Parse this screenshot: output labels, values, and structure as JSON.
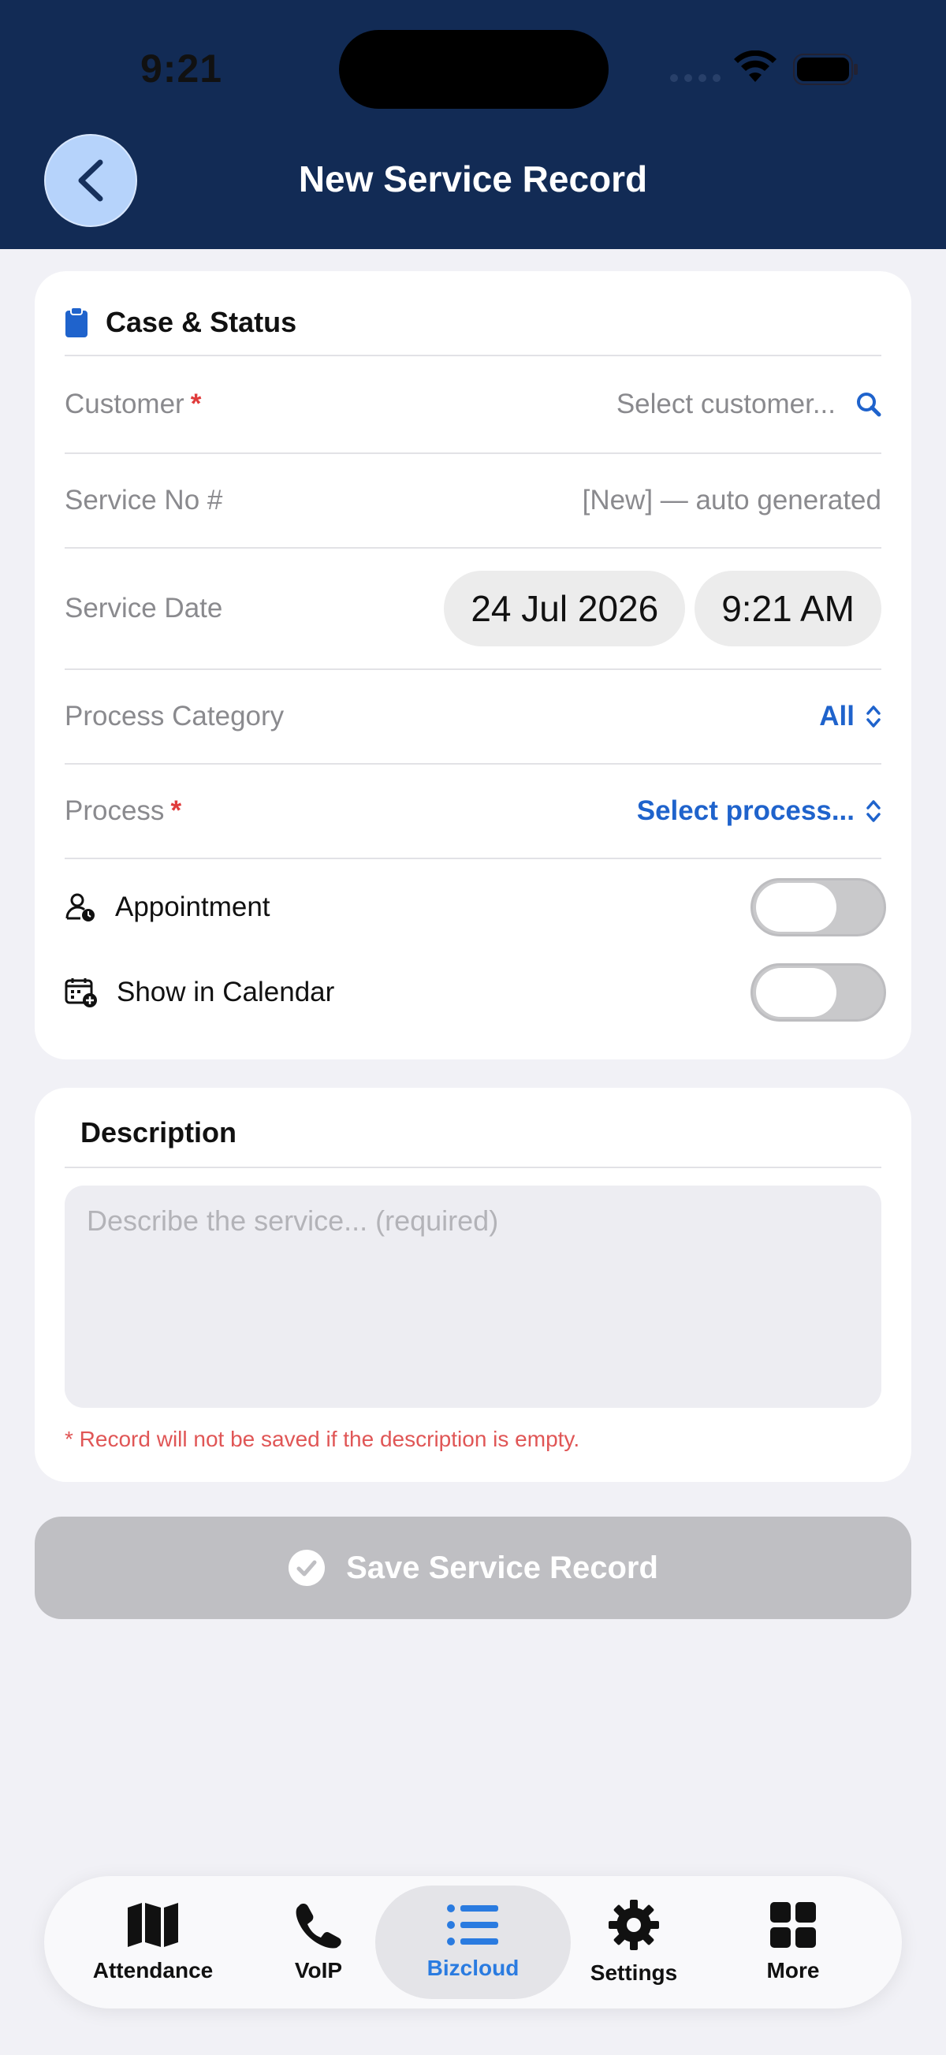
{
  "status_bar": {
    "time": "9:21"
  },
  "header": {
    "title": "New Service Record"
  },
  "case_section": {
    "title": "Case & Status",
    "customer": {
      "label": "Customer",
      "required": "*",
      "value": "Select customer..."
    },
    "service_no": {
      "label": "Service No #",
      "value": "[New] — auto generated"
    },
    "service_date": {
      "label": "Service Date",
      "date": "24 Jul 2026",
      "time": "9:21 AM"
    },
    "process_category": {
      "label": "Process Category",
      "value": "All"
    },
    "process": {
      "label": "Process",
      "required": "*",
      "value": "Select process..."
    },
    "appointment": {
      "label": "Appointment",
      "on": false
    },
    "show_in_calendar": {
      "label": "Show in Calendar",
      "on": false
    }
  },
  "description_section": {
    "title": "Description",
    "placeholder": "Describe the service... (required)",
    "warning": "* Record will not be saved if the description is empty."
  },
  "save_button": {
    "label": "Save Service Record"
  },
  "tabbar": {
    "tabs": [
      {
        "label": "Attendance",
        "icon": "map-icon"
      },
      {
        "label": "VoIP",
        "icon": "phone-icon"
      },
      {
        "label": "Bizcloud",
        "icon": "list-icon",
        "active": true
      },
      {
        "label": "Settings",
        "icon": "gear-icon"
      },
      {
        "label": "More",
        "icon": "grid-icon"
      }
    ]
  },
  "colors": {
    "header_bg": "#122b55",
    "accent_blue": "#1f63cc",
    "required_red": "#e03b3b",
    "active_tab": "#2a7be0"
  }
}
